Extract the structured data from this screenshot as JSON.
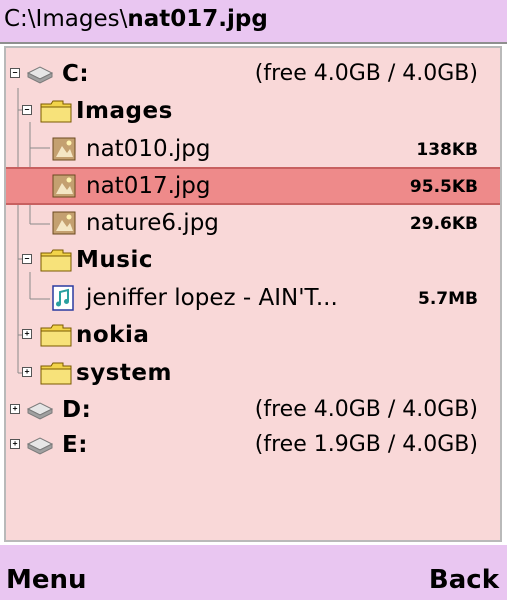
{
  "title": {
    "prefix": "C:\\Images\\",
    "file": "nat017.jpg"
  },
  "tree": {
    "drive_c": {
      "label": "C:",
      "info": "(free 4.0GB / 4.0GB)"
    },
    "images_folder": {
      "label": "Images"
    },
    "files_images": [
      {
        "name": "nat010.jpg",
        "size": "138KB"
      },
      {
        "name": "nat017.jpg",
        "size": "95.5KB"
      },
      {
        "name": "nature6.jpg",
        "size": "29.6KB"
      }
    ],
    "music_folder": {
      "label": "Music"
    },
    "music_file": {
      "name": "jeniffer lopez - AIN'T...",
      "size": "5.7MB"
    },
    "nokia_folder": {
      "label": "nokia"
    },
    "system_folder": {
      "label": "system"
    },
    "drive_d": {
      "label": "D:",
      "info": "(free 4.0GB / 4.0GB)"
    },
    "drive_e": {
      "label": "E:",
      "info": "(free 1.9GB / 4.0GB)"
    },
    "toggles": {
      "expanded": "−",
      "collapsed": "+"
    }
  },
  "softkeys": {
    "left": "Menu",
    "right": "Back"
  },
  "colors": {
    "titlebar": "#e9c6f1",
    "pane_bg": "#f9d8d8",
    "selection": "#ee8a8a",
    "folder": "#f2d34a",
    "softbar": "#e9c6f1"
  },
  "icons": {
    "drive": "drive-icon",
    "folder": "folder-icon",
    "image": "image-file-icon",
    "music": "music-file-icon"
  }
}
